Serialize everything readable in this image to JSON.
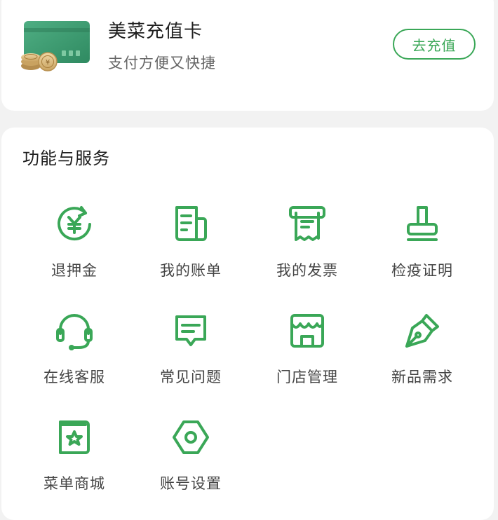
{
  "recharge_card": {
    "title": "美菜充值卡",
    "subtitle": "支付方便又快捷",
    "button_label": "去充值"
  },
  "services": {
    "title": "功能与服务",
    "items": [
      {
        "label": "退押金",
        "icon": "deposit-refund-icon"
      },
      {
        "label": "我的账单",
        "icon": "bill-icon"
      },
      {
        "label": "我的发票",
        "icon": "invoice-icon"
      },
      {
        "label": "检疫证明",
        "icon": "stamp-icon"
      },
      {
        "label": "在线客服",
        "icon": "headset-icon"
      },
      {
        "label": "常见问题",
        "icon": "faq-message-icon"
      },
      {
        "label": "门店管理",
        "icon": "store-icon"
      },
      {
        "label": "新品需求",
        "icon": "pen-nib-icon"
      },
      {
        "label": "菜单商城",
        "icon": "menu-book-icon"
      },
      {
        "label": "账号设置",
        "icon": "settings-hexagon-icon"
      }
    ]
  },
  "colors": {
    "accent": "#3aa757",
    "card_green": "#3a9a6e",
    "coin_gold": "#d9b77a"
  }
}
